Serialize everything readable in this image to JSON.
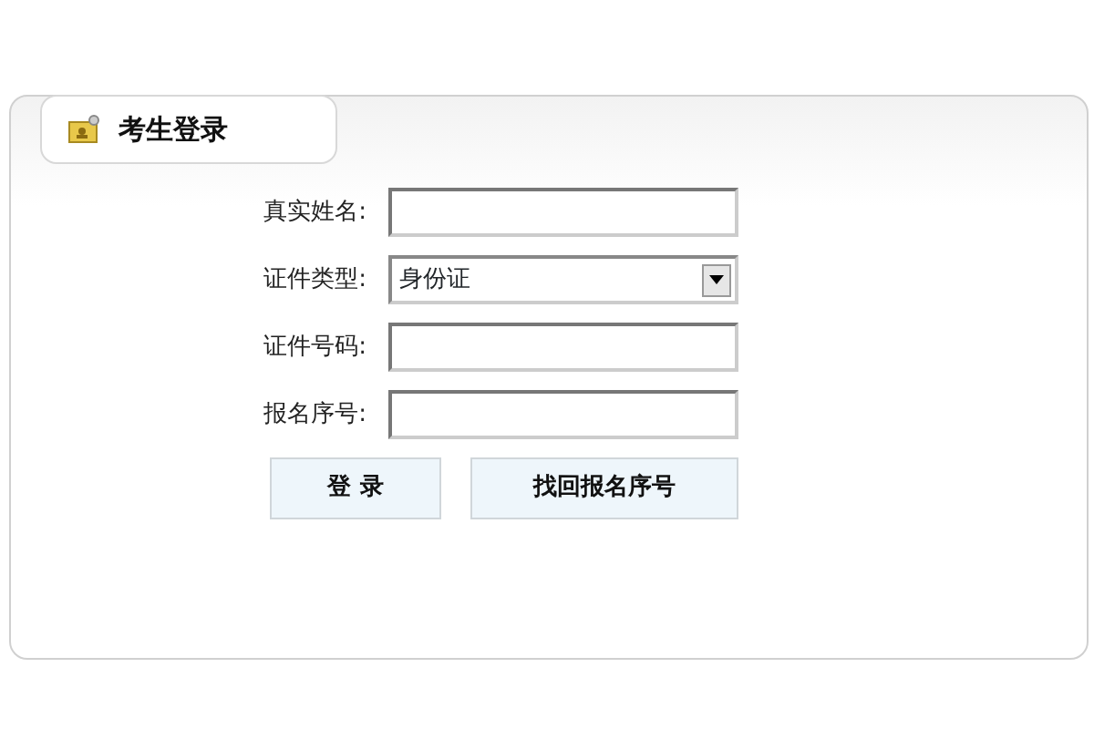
{
  "panel": {
    "title": "考生登录"
  },
  "fields": [
    {
      "label": "真实姓名:",
      "kind": "text"
    },
    {
      "label": "证件类型:",
      "kind": "select",
      "value": "身份证"
    },
    {
      "label": "证件号码:",
      "kind": "text"
    },
    {
      "label": "报名序号:",
      "kind": "text"
    }
  ],
  "buttons": [
    {
      "label": "登 录"
    },
    {
      "label": "找回报名序号"
    }
  ]
}
